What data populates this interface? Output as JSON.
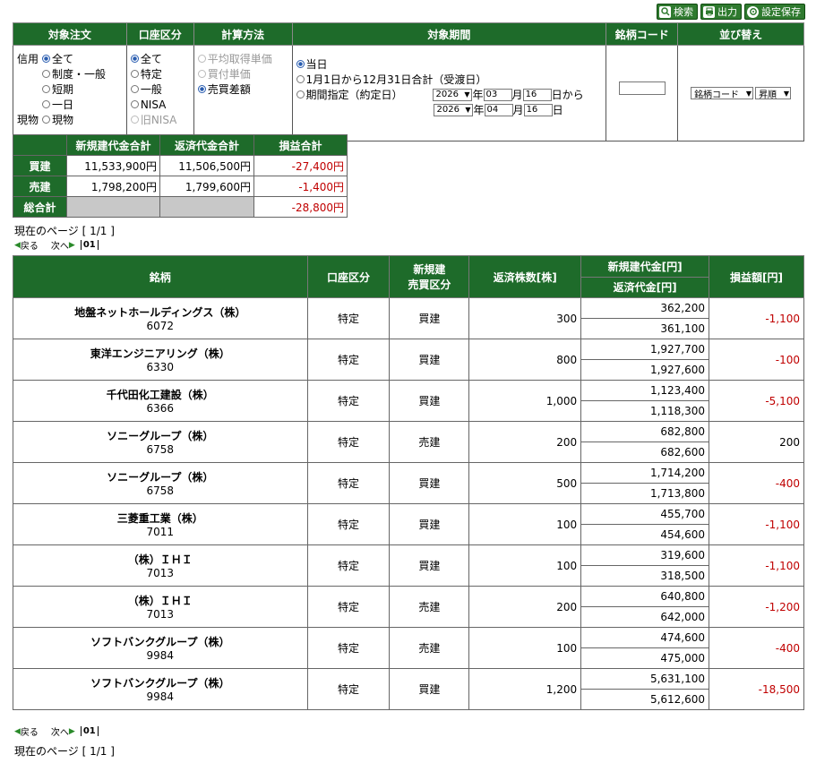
{
  "toolbar": {
    "search": "検索",
    "output": "出力",
    "save": "設定保存"
  },
  "conditions": {
    "headers": [
      "対象注文",
      "口座区分",
      "計算方法",
      "対象期間",
      "銘柄コード",
      "並び替え"
    ],
    "order": {
      "credit_label": "信用",
      "credit_options": [
        "全て",
        "制度・一般",
        "短期",
        "一日"
      ],
      "spot_label": "現物",
      "spot_option": "現物"
    },
    "account": [
      "全て",
      "特定",
      "一般",
      "NISA",
      "旧NISA"
    ],
    "method": [
      "平均取得単価",
      "買付単価",
      "売買差額"
    ],
    "period": {
      "today": "当日",
      "yearly": "1月1日から12月31日合計（受渡日）",
      "range": "期間指定（約定日）",
      "from_year": "2026",
      "from_month": "03",
      "from_day": "16",
      "to_year": "2026",
      "to_month": "04",
      "to_day": "16",
      "year_label": "年",
      "month_label": "月",
      "day_from_label": "日から",
      "day_to_label": "日"
    },
    "code_value": "",
    "sort_field": "銘柄コード",
    "sort_order": "昇順"
  },
  "summary": {
    "headers": [
      "新規建代金合計",
      "返済代金合計",
      "損益合計"
    ],
    "rows": [
      {
        "label": "買建",
        "new": "11,533,900円",
        "ret": "11,506,500円",
        "pl": "-27,400円"
      },
      {
        "label": "売建",
        "new": "1,798,200円",
        "ret": "1,799,600円",
        "pl": "-1,400円"
      },
      {
        "label": "総合計",
        "pl": "-28,800円"
      }
    ]
  },
  "paging": {
    "current": "現在のページ [ 1/1 ]",
    "prev": "戻る",
    "next": "次へ",
    "page": "01"
  },
  "table": {
    "headers": {
      "name": "銘柄",
      "account": "口座区分",
      "side1": "新規建",
      "side2": "売買区分",
      "qty": "返済株数[株]",
      "newamt": "新規建代金[円]",
      "retamt": "返済代金[円]",
      "pl": "損益額[円]"
    },
    "rows": [
      {
        "name": "地盤ネットホールディングス（株）",
        "code": "6072",
        "account": "特定",
        "side": "買建",
        "qty": "300",
        "new": "362,200",
        "ret": "361,100",
        "pl": "-1,100"
      },
      {
        "name": "東洋エンジニアリング（株）",
        "code": "6330",
        "account": "特定",
        "side": "買建",
        "qty": "800",
        "new": "1,927,700",
        "ret": "1,927,600",
        "pl": "-100"
      },
      {
        "name": "千代田化工建設（株）",
        "code": "6366",
        "account": "特定",
        "side": "買建",
        "qty": "1,000",
        "new": "1,123,400",
        "ret": "1,118,300",
        "pl": "-5,100"
      },
      {
        "name": "ソニーグループ（株）",
        "code": "6758",
        "account": "特定",
        "side": "売建",
        "qty": "200",
        "new": "682,800",
        "ret": "682,600",
        "pl": "200"
      },
      {
        "name": "ソニーグループ（株）",
        "code": "6758",
        "account": "特定",
        "side": "買建",
        "qty": "500",
        "new": "1,714,200",
        "ret": "1,713,800",
        "pl": "-400"
      },
      {
        "name": "三菱重工業（株）",
        "code": "7011",
        "account": "特定",
        "side": "買建",
        "qty": "100",
        "new": "455,700",
        "ret": "454,600",
        "pl": "-1,100"
      },
      {
        "name": "（株）ＩＨＩ",
        "code": "7013",
        "account": "特定",
        "side": "買建",
        "qty": "100",
        "new": "319,600",
        "ret": "318,500",
        "pl": "-1,100"
      },
      {
        "name": "（株）ＩＨＩ",
        "code": "7013",
        "account": "特定",
        "side": "売建",
        "qty": "200",
        "new": "640,800",
        "ret": "642,000",
        "pl": "-1,200"
      },
      {
        "name": "ソフトバンクグループ（株）",
        "code": "9984",
        "account": "特定",
        "side": "売建",
        "qty": "100",
        "new": "474,600",
        "ret": "475,000",
        "pl": "-400"
      },
      {
        "name": "ソフトバンクグループ（株）",
        "code": "9984",
        "account": "特定",
        "side": "買建",
        "qty": "1,200",
        "new": "5,631,100",
        "ret": "5,612,600",
        "pl": "-18,500"
      }
    ]
  }
}
